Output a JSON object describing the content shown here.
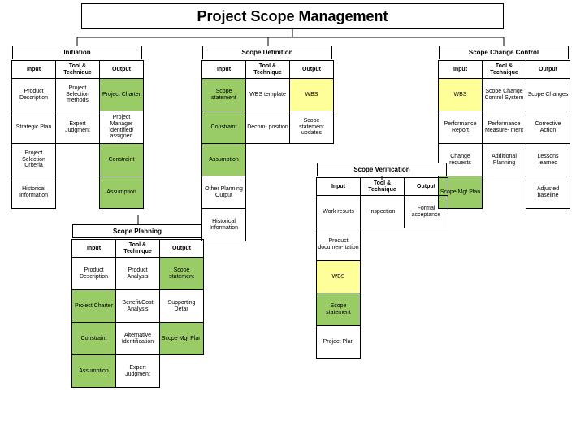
{
  "title": "Project Scope Management",
  "sections": {
    "initiation": "Initiation",
    "definition": "Scope Definition",
    "change": "Scope Change Control",
    "planning": "Scope Planning",
    "verification": "Scope Verification"
  },
  "hdr": {
    "input": "Input",
    "tool": "Tool & Technique",
    "output": "Output"
  },
  "initiation": {
    "r1": {
      "c1": "Product Description",
      "c2": "Project Selection methods",
      "c3": "Project Charter"
    },
    "r2": {
      "c1": "Strategic Plan",
      "c2": "Expert Judgment",
      "c3": "Project Manager identified/ assigned"
    },
    "r3": {
      "c1": "Project Selection Criteria",
      "c3": "Constraint"
    },
    "r4": {
      "c1": "Historical Information",
      "c3": "Assumption"
    }
  },
  "planning": {
    "r1": {
      "c1": "Product Description",
      "c2": "Product Analysis",
      "c3": "Scope statement"
    },
    "r2": {
      "c1": "Project Charter",
      "c2": "Benefit/Cost Analysis",
      "c3": "Supporting Detail"
    },
    "r3": {
      "c1": "Constraint",
      "c2": "Alternative Identification",
      "c3": "Scope Mgt Plan"
    },
    "r4": {
      "c1": "Assumption",
      "c2": "Expert Judgment"
    }
  },
  "definition": {
    "r1": {
      "c1": "Scope statement",
      "c2": "WBS template",
      "c3": "WBS"
    },
    "r2": {
      "c1": "Constraint",
      "c2": "Decom- position",
      "c3": "Scope statement updates"
    },
    "r3": {
      "c1": "Assumption"
    },
    "r4": {
      "c1": "Other Planning Output"
    },
    "r5": {
      "c1": "Historical Information"
    }
  },
  "verification": {
    "r1": {
      "c1": "Work results",
      "c2": "Inspection",
      "c3": "Formal acceptance"
    },
    "r2": {
      "c1": "Product documen- tation"
    },
    "r3": {
      "c1": "WBS"
    },
    "r4": {
      "c1": "Scope statement"
    },
    "r5": {
      "c1": "Project Plan"
    }
  },
  "change": {
    "r1": {
      "c1": "WBS",
      "c2": "Scope Change Control System",
      "c3": "Scope Changes"
    },
    "r2": {
      "c1": "Performance Report",
      "c2": "Performance Measure- ment",
      "c3": "Corrective Action"
    },
    "r3": {
      "c1": "Change requests",
      "c2": "Additional Planning",
      "c3": "Lessons learned"
    },
    "r4": {
      "c1": "Scope Mgt Plan",
      "c3": "Adjusted baseline"
    }
  }
}
